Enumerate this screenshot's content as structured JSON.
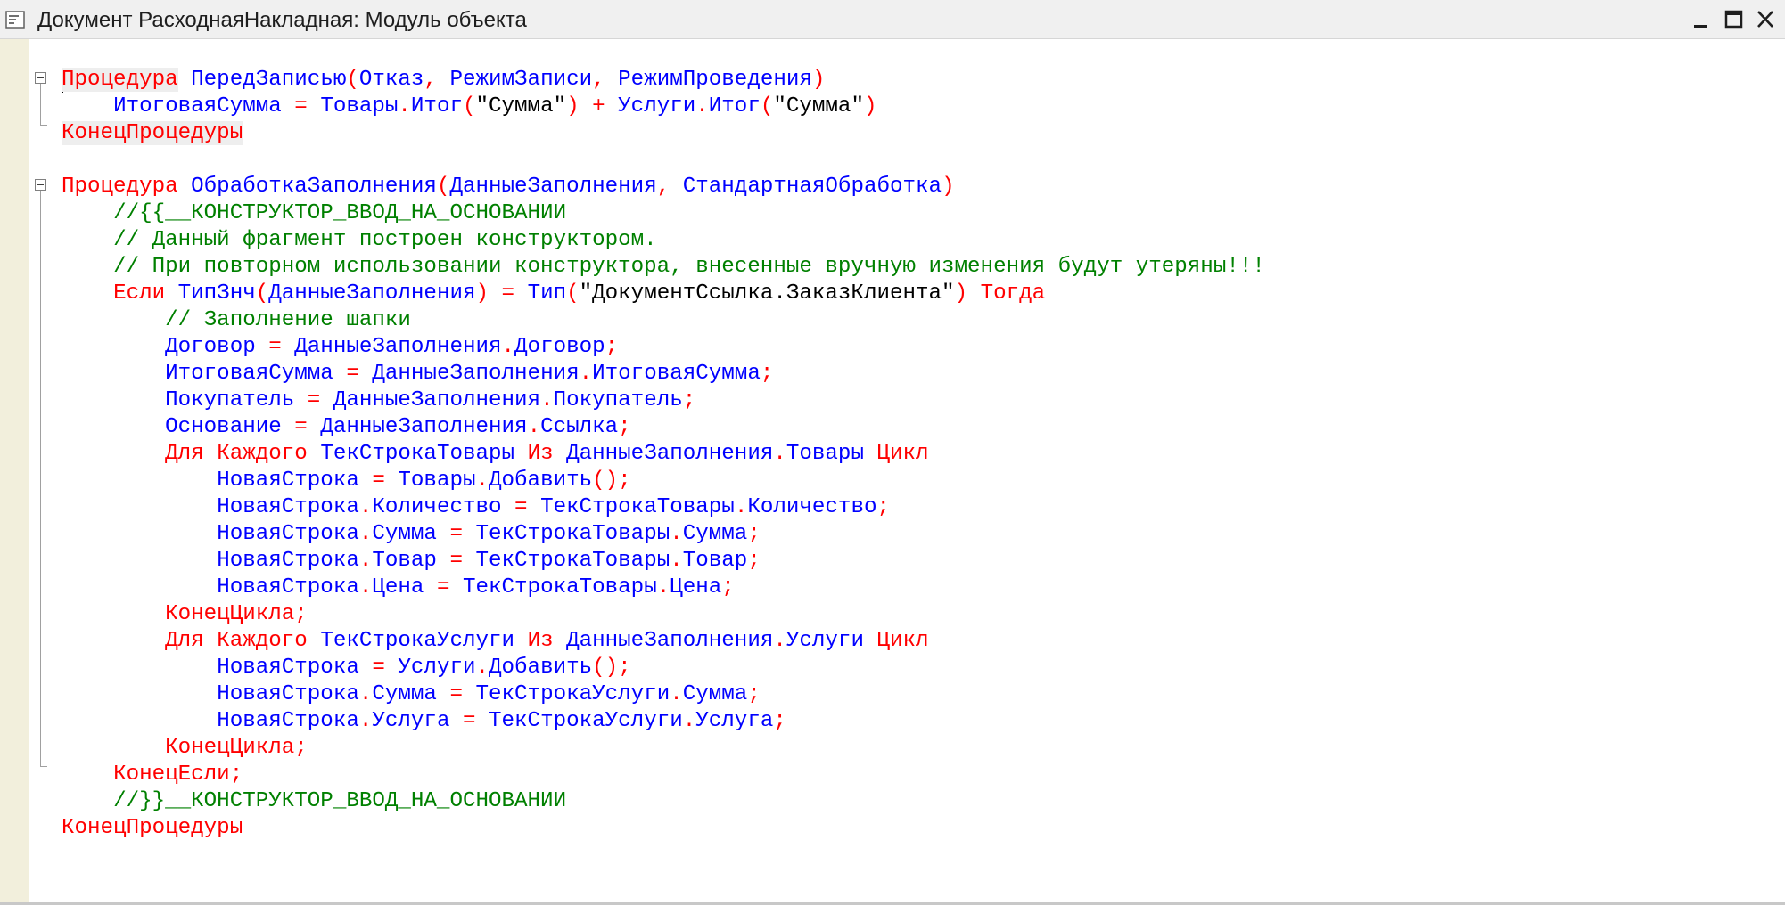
{
  "window": {
    "title": "Документ РасходнаяНакладная: Модуль объекта",
    "icon": "module-icon",
    "controls": [
      "minimize-icon",
      "maximize-icon",
      "close-icon"
    ]
  },
  "code_lines": [
    {
      "indent": 0,
      "tokens": [
        {
          "t": "Процедура",
          "c": "kw hl"
        },
        {
          "t": " ",
          "c": ""
        },
        {
          "t": "ПередЗаписью",
          "c": "id"
        },
        {
          "t": "(",
          "c": "op"
        },
        {
          "t": "Отказ",
          "c": "id"
        },
        {
          "t": ", ",
          "c": "op"
        },
        {
          "t": "РежимЗаписи",
          "c": "id"
        },
        {
          "t": ", ",
          "c": "op"
        },
        {
          "t": "РежимПроведения",
          "c": "id"
        },
        {
          "t": ")",
          "c": "op"
        }
      ]
    },
    {
      "indent": 4,
      "tokens": [
        {
          "t": "ИтоговаяСумма",
          "c": "id"
        },
        {
          "t": " = ",
          "c": "op"
        },
        {
          "t": "Товары",
          "c": "id"
        },
        {
          "t": ".",
          "c": "op"
        },
        {
          "t": "Итог",
          "c": "id"
        },
        {
          "t": "(",
          "c": "op"
        },
        {
          "t": "\"Сумма\"",
          "c": "str"
        },
        {
          "t": ")",
          "c": "op"
        },
        {
          "t": " + ",
          "c": "op"
        },
        {
          "t": "Услуги",
          "c": "id"
        },
        {
          "t": ".",
          "c": "op"
        },
        {
          "t": "Итог",
          "c": "id"
        },
        {
          "t": "(",
          "c": "op"
        },
        {
          "t": "\"Сумма\"",
          "c": "str"
        },
        {
          "t": ")",
          "c": "op"
        }
      ]
    },
    {
      "indent": 0,
      "tokens": [
        {
          "t": "КонецПроцедуры",
          "c": "kw hl"
        }
      ]
    },
    {
      "indent": 0,
      "tokens": []
    },
    {
      "indent": 0,
      "tokens": [
        {
          "t": "Процедура",
          "c": "kw"
        },
        {
          "t": " ",
          "c": ""
        },
        {
          "t": "ОбработкаЗаполнения",
          "c": "id"
        },
        {
          "t": "(",
          "c": "op"
        },
        {
          "t": "ДанныеЗаполнения",
          "c": "id"
        },
        {
          "t": ", ",
          "c": "op"
        },
        {
          "t": "СтандартнаяОбработка",
          "c": "id"
        },
        {
          "t": ")",
          "c": "op"
        }
      ]
    },
    {
      "indent": 4,
      "tokens": [
        {
          "t": "//{{__КОНСТРУКТОР_ВВОД_НА_ОСНОВАНИИ",
          "c": "cm"
        }
      ]
    },
    {
      "indent": 4,
      "tokens": [
        {
          "t": "// Данный фрагмент построен конструктором.",
          "c": "cm"
        }
      ]
    },
    {
      "indent": 4,
      "tokens": [
        {
          "t": "// При повторном использовании конструктора, внесенные вручную изменения будут утеряны!!!",
          "c": "cm"
        }
      ]
    },
    {
      "indent": 4,
      "tokens": [
        {
          "t": "Если",
          "c": "kw"
        },
        {
          "t": " ",
          "c": ""
        },
        {
          "t": "ТипЗнч",
          "c": "id"
        },
        {
          "t": "(",
          "c": "op"
        },
        {
          "t": "ДанныеЗаполнения",
          "c": "id"
        },
        {
          "t": ")",
          "c": "op"
        },
        {
          "t": " = ",
          "c": "op"
        },
        {
          "t": "Тип",
          "c": "id"
        },
        {
          "t": "(",
          "c": "op"
        },
        {
          "t": "\"ДокументСсылка.ЗаказКлиента\"",
          "c": "str"
        },
        {
          "t": ")",
          "c": "op"
        },
        {
          "t": " ",
          "c": ""
        },
        {
          "t": "Тогда",
          "c": "kw"
        }
      ]
    },
    {
      "indent": 8,
      "tokens": [
        {
          "t": "// Заполнение шапки",
          "c": "cm"
        }
      ]
    },
    {
      "indent": 8,
      "tokens": [
        {
          "t": "Договор",
          "c": "id"
        },
        {
          "t": " = ",
          "c": "op"
        },
        {
          "t": "ДанныеЗаполнения",
          "c": "id"
        },
        {
          "t": ".",
          "c": "op"
        },
        {
          "t": "Договор",
          "c": "id"
        },
        {
          "t": ";",
          "c": "op"
        }
      ]
    },
    {
      "indent": 8,
      "tokens": [
        {
          "t": "ИтоговаяСумма",
          "c": "id"
        },
        {
          "t": " = ",
          "c": "op"
        },
        {
          "t": "ДанныеЗаполнения",
          "c": "id"
        },
        {
          "t": ".",
          "c": "op"
        },
        {
          "t": "ИтоговаяСумма",
          "c": "id"
        },
        {
          "t": ";",
          "c": "op"
        }
      ]
    },
    {
      "indent": 8,
      "tokens": [
        {
          "t": "Покупатель",
          "c": "id"
        },
        {
          "t": " = ",
          "c": "op"
        },
        {
          "t": "ДанныеЗаполнения",
          "c": "id"
        },
        {
          "t": ".",
          "c": "op"
        },
        {
          "t": "Покупатель",
          "c": "id"
        },
        {
          "t": ";",
          "c": "op"
        }
      ]
    },
    {
      "indent": 8,
      "tokens": [
        {
          "t": "Основание",
          "c": "id"
        },
        {
          "t": " = ",
          "c": "op"
        },
        {
          "t": "ДанныеЗаполнения",
          "c": "id"
        },
        {
          "t": ".",
          "c": "op"
        },
        {
          "t": "Ссылка",
          "c": "id"
        },
        {
          "t": ";",
          "c": "op"
        }
      ]
    },
    {
      "indent": 8,
      "tokens": [
        {
          "t": "Для",
          "c": "kw"
        },
        {
          "t": " ",
          "c": ""
        },
        {
          "t": "Каждого",
          "c": "kw"
        },
        {
          "t": " ",
          "c": ""
        },
        {
          "t": "ТекСтрокаТовары",
          "c": "id"
        },
        {
          "t": " ",
          "c": ""
        },
        {
          "t": "Из",
          "c": "kw"
        },
        {
          "t": " ",
          "c": ""
        },
        {
          "t": "ДанныеЗаполнения",
          "c": "id"
        },
        {
          "t": ".",
          "c": "op"
        },
        {
          "t": "Товары",
          "c": "id"
        },
        {
          "t": " ",
          "c": ""
        },
        {
          "t": "Цикл",
          "c": "kw"
        }
      ]
    },
    {
      "indent": 12,
      "tokens": [
        {
          "t": "НоваяСтрока",
          "c": "id"
        },
        {
          "t": " = ",
          "c": "op"
        },
        {
          "t": "Товары",
          "c": "id"
        },
        {
          "t": ".",
          "c": "op"
        },
        {
          "t": "Добавить",
          "c": "id"
        },
        {
          "t": "();",
          "c": "op"
        }
      ]
    },
    {
      "indent": 12,
      "tokens": [
        {
          "t": "НоваяСтрока",
          "c": "id"
        },
        {
          "t": ".",
          "c": "op"
        },
        {
          "t": "Количество",
          "c": "id"
        },
        {
          "t": " = ",
          "c": "op"
        },
        {
          "t": "ТекСтрокаТовары",
          "c": "id"
        },
        {
          "t": ".",
          "c": "op"
        },
        {
          "t": "Количество",
          "c": "id"
        },
        {
          "t": ";",
          "c": "op"
        }
      ]
    },
    {
      "indent": 12,
      "tokens": [
        {
          "t": "НоваяСтрока",
          "c": "id"
        },
        {
          "t": ".",
          "c": "op"
        },
        {
          "t": "Сумма",
          "c": "id"
        },
        {
          "t": " = ",
          "c": "op"
        },
        {
          "t": "ТекСтрокаТовары",
          "c": "id"
        },
        {
          "t": ".",
          "c": "op"
        },
        {
          "t": "Сумма",
          "c": "id"
        },
        {
          "t": ";",
          "c": "op"
        }
      ]
    },
    {
      "indent": 12,
      "tokens": [
        {
          "t": "НоваяСтрока",
          "c": "id"
        },
        {
          "t": ".",
          "c": "op"
        },
        {
          "t": "Товар",
          "c": "id"
        },
        {
          "t": " = ",
          "c": "op"
        },
        {
          "t": "ТекСтрокаТовары",
          "c": "id"
        },
        {
          "t": ".",
          "c": "op"
        },
        {
          "t": "Товар",
          "c": "id"
        },
        {
          "t": ";",
          "c": "op"
        }
      ]
    },
    {
      "indent": 12,
      "tokens": [
        {
          "t": "НоваяСтрока",
          "c": "id"
        },
        {
          "t": ".",
          "c": "op"
        },
        {
          "t": "Цена",
          "c": "id"
        },
        {
          "t": " = ",
          "c": "op"
        },
        {
          "t": "ТекСтрокаТовары",
          "c": "id"
        },
        {
          "t": ".",
          "c": "op"
        },
        {
          "t": "Цена",
          "c": "id"
        },
        {
          "t": ";",
          "c": "op"
        }
      ]
    },
    {
      "indent": 8,
      "tokens": [
        {
          "t": "КонецЦикла",
          "c": "kw"
        },
        {
          "t": ";",
          "c": "op"
        }
      ]
    },
    {
      "indent": 8,
      "tokens": [
        {
          "t": "Для",
          "c": "kw"
        },
        {
          "t": " ",
          "c": ""
        },
        {
          "t": "Каждого",
          "c": "kw"
        },
        {
          "t": " ",
          "c": ""
        },
        {
          "t": "ТекСтрокаУслуги",
          "c": "id"
        },
        {
          "t": " ",
          "c": ""
        },
        {
          "t": "Из",
          "c": "kw"
        },
        {
          "t": " ",
          "c": ""
        },
        {
          "t": "ДанныеЗаполнения",
          "c": "id"
        },
        {
          "t": ".",
          "c": "op"
        },
        {
          "t": "Услуги",
          "c": "id"
        },
        {
          "t": " ",
          "c": ""
        },
        {
          "t": "Цикл",
          "c": "kw"
        }
      ]
    },
    {
      "indent": 12,
      "tokens": [
        {
          "t": "НоваяСтрока",
          "c": "id"
        },
        {
          "t": " = ",
          "c": "op"
        },
        {
          "t": "Услуги",
          "c": "id"
        },
        {
          "t": ".",
          "c": "op"
        },
        {
          "t": "Добавить",
          "c": "id"
        },
        {
          "t": "();",
          "c": "op"
        }
      ]
    },
    {
      "indent": 12,
      "tokens": [
        {
          "t": "НоваяСтрока",
          "c": "id"
        },
        {
          "t": ".",
          "c": "op"
        },
        {
          "t": "Сумма",
          "c": "id"
        },
        {
          "t": " = ",
          "c": "op"
        },
        {
          "t": "ТекСтрокаУслуги",
          "c": "id"
        },
        {
          "t": ".",
          "c": "op"
        },
        {
          "t": "Сумма",
          "c": "id"
        },
        {
          "t": ";",
          "c": "op"
        }
      ]
    },
    {
      "indent": 12,
      "tokens": [
        {
          "t": "НоваяСтрока",
          "c": "id"
        },
        {
          "t": ".",
          "c": "op"
        },
        {
          "t": "Услуга",
          "c": "id"
        },
        {
          "t": " = ",
          "c": "op"
        },
        {
          "t": "ТекСтрокаУслуги",
          "c": "id"
        },
        {
          "t": ".",
          "c": "op"
        },
        {
          "t": "Услуга",
          "c": "id"
        },
        {
          "t": ";",
          "c": "op"
        }
      ]
    },
    {
      "indent": 8,
      "tokens": [
        {
          "t": "КонецЦикла",
          "c": "kw"
        },
        {
          "t": ";",
          "c": "op"
        }
      ]
    },
    {
      "indent": 4,
      "tokens": [
        {
          "t": "КонецЕсли",
          "c": "kw"
        },
        {
          "t": ";",
          "c": "op"
        }
      ]
    },
    {
      "indent": 4,
      "tokens": [
        {
          "t": "//}}__КОНСТРУКТОР_ВВОД_НА_ОСНОВАНИИ",
          "c": "cm"
        }
      ]
    },
    {
      "indent": 0,
      "tokens": [
        {
          "t": "КонецПроцедуры",
          "c": "kw"
        }
      ]
    }
  ],
  "colors": {
    "keyword": "#ff0000",
    "identifier": "#0000ff",
    "string": "#000000",
    "comment": "#008000",
    "gutter": "#f2efdc"
  }
}
